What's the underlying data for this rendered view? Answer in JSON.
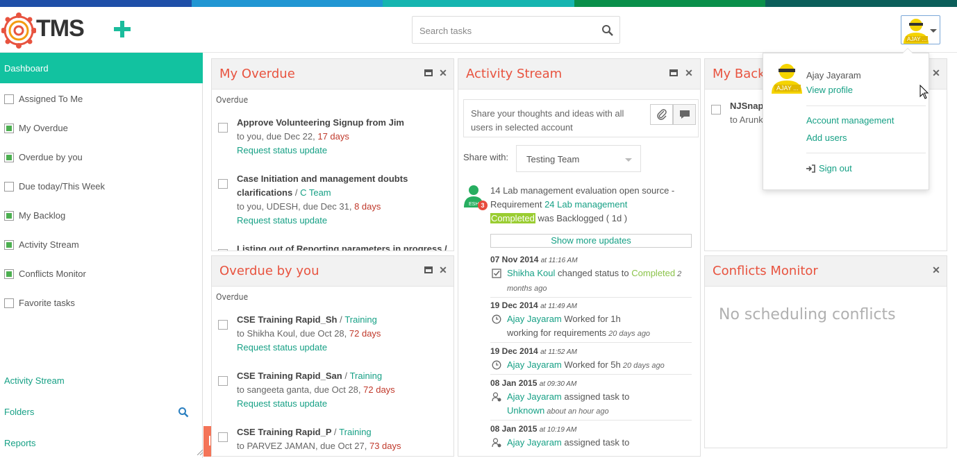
{
  "colors": {
    "accent": "#12c2a0",
    "link": "#16a085",
    "title_red": "#e8533f",
    "strip": [
      "#1f4fa8",
      "#2196d3",
      "#16b5b0",
      "#0a8f4a",
      "#0b5e5a"
    ]
  },
  "header": {
    "logo_text": "TMS",
    "search_placeholder": "Search tasks",
    "avatar_label": "AJAY ..."
  },
  "sidebar": {
    "active": "Dashboard",
    "items": [
      {
        "label": "Assigned To Me",
        "checked": false
      },
      {
        "label": "My Overdue",
        "checked": true
      },
      {
        "label": "Overdue by you",
        "checked": true
      },
      {
        "label": "Due today/This Week",
        "checked": false
      },
      {
        "label": "My Backlog",
        "checked": true
      },
      {
        "label": "Activity Stream",
        "checked": true
      },
      {
        "label": "Conflicts Monitor",
        "checked": true
      },
      {
        "label": "Favorite tasks",
        "checked": false
      }
    ],
    "links": [
      "Activity Stream",
      "Folders",
      "Reports"
    ]
  },
  "my_overdue": {
    "title": "My Overdue",
    "section": "Overdue",
    "tasks": [
      {
        "title": "Approve Volunteering Signup from Jim",
        "team": "",
        "sub": "to you, due Dec 22, ",
        "days": "17 days",
        "link": "Request status update"
      },
      {
        "title": "Case Initiation and management doubts clarifications",
        "team": "C Team",
        "sub": "to you, UDESH, due Dec 31, ",
        "days": "8 days",
        "link": "Request status update"
      },
      {
        "title": "Listing out of Reporting parameters in progress /",
        "team": "",
        "sub": "",
        "days": "",
        "link": ""
      }
    ]
  },
  "overdue_by_you": {
    "title": "Overdue by you",
    "section": "Overdue",
    "tasks": [
      {
        "title": "CSE Training Rapid_Sh",
        "team": "Training",
        "sub": "to Shikha Koul, due Oct 28, ",
        "days": "72 days",
        "link": "Request status update"
      },
      {
        "title": "CSE Training Rapid_San",
        "team": "Training",
        "sub": "to sangeeta ganta, due Oct 28, ",
        "days": "72 days",
        "link": "Request status update"
      },
      {
        "title": "CSE Training Rapid_P",
        "team": "Training",
        "sub": "to PARVEZ JAMAN, due Oct 27, ",
        "days": "73 days",
        "link": ""
      }
    ]
  },
  "activity": {
    "title": "Activity Stream",
    "share_placeholder": "Share your thoughts and ideas with all users in selected account",
    "share_with_label": "Share with:",
    "share_with_value": "Testing Team",
    "badge": "3",
    "avatar_label": "ESH",
    "item_text": "14 Lab management evaluation open source - Requirement",
    "item_link": "24 Lab management",
    "item_status": "Completed",
    "item_tail": " was Backlogged ( 1d )",
    "more": "Show more updates",
    "updates": [
      {
        "date": "07 Nov 2014",
        "time": "at 11:16 AM",
        "icon": "checkbox-icon",
        "user": "Shikha Koul",
        "action": " changed status to ",
        "status": "Completed",
        "extra": "",
        "ago": " 2 months ago"
      },
      {
        "date": "19 Dec 2014",
        "time": "at 11:49 AM",
        "icon": "clock-icon",
        "user": "Ajay Jayaram",
        "action": " Worked for 1h",
        "status": "",
        "extra": "working for requirements",
        "ago": " 20 days ago"
      },
      {
        "date": "19 Dec 2014",
        "time": "at 11:52 AM",
        "icon": "clock-icon",
        "user": "Ajay Jayaram",
        "action": " Worked for 5h",
        "status": "",
        "extra": "",
        "ago": " 20 days ago"
      },
      {
        "date": "08 Jan 2015",
        "time": "at 09:30 AM",
        "icon": "assign-icon",
        "user": "Ajay Jayaram",
        "action": " assigned task to",
        "status": "",
        "extra": "Unknown",
        "ago": " about an hour ago"
      },
      {
        "date": "08 Jan 2015",
        "time": "at 10:19 AM",
        "icon": "assign-icon",
        "user": "Ajay Jayaram",
        "action": " assigned task to",
        "status": "",
        "extra": "",
        "ago": ""
      }
    ]
  },
  "my_backlog": {
    "title": "My Backlo",
    "task_title": "NJSnap",
    "task_sub": "to Arunk"
  },
  "conflicts": {
    "title": "Conflicts Monitor",
    "empty": "No scheduling conflicts"
  },
  "user_menu": {
    "name": "Ajay Jayaram",
    "view_profile": "View profile",
    "account": "Account management",
    "add_users": "Add users",
    "sign_out": "Sign out",
    "avatar_label": "AJAY ..."
  }
}
